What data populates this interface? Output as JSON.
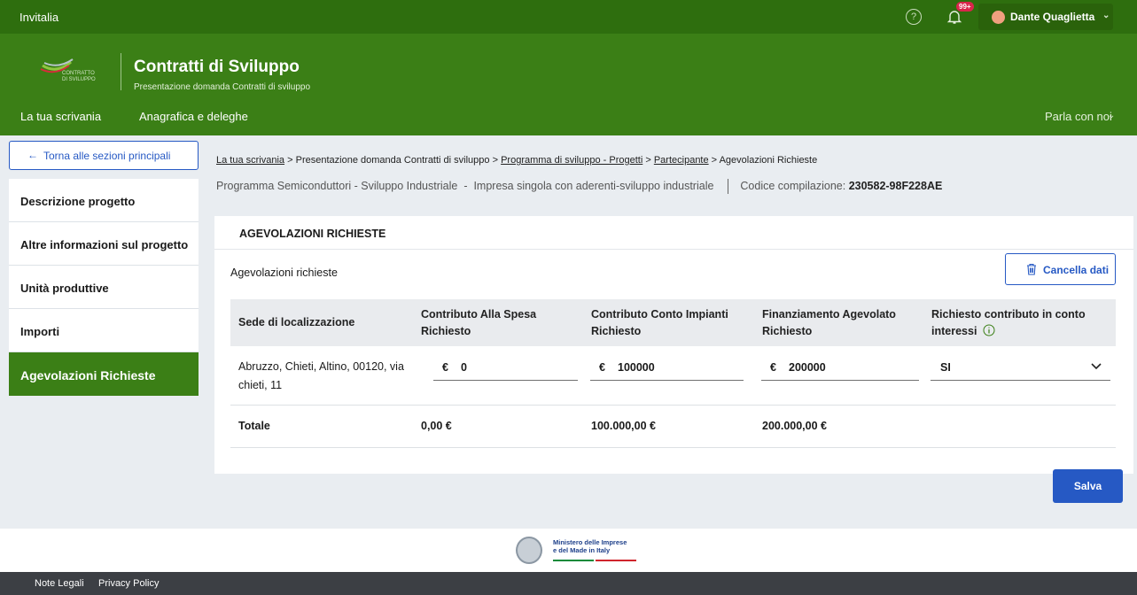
{
  "topbar": {
    "brand": "Invitalia",
    "help_glyph": "?",
    "notification_badge": "99+",
    "user_name": "Dante Quaglietta",
    "user_chevron": "⌄"
  },
  "header": {
    "logo_text_line1": "CONTRATTO",
    "logo_text_line2": "DI SVILUPPO",
    "title": "Contratti di Sviluppo",
    "subtitle": "Presentazione domanda Contratti di sviluppo",
    "nav": [
      "La tua scrivania",
      "Anagrafica e deleghe"
    ],
    "contact": "Parla con noi",
    "contact_chevron": "⌄"
  },
  "sidebar": {
    "back_arrow": "←",
    "back_label": "Torna alle sezioni principali",
    "items": [
      {
        "label": "Descrizione progetto"
      },
      {
        "label": "Altre informazioni sul progetto"
      },
      {
        "label": "Unità produttive"
      },
      {
        "label": "Importi"
      },
      {
        "label": "Agevolazioni Richieste",
        "active": true
      }
    ]
  },
  "breadcrumb": {
    "items": [
      "La tua scrivania",
      "Presentazione domanda Contratti di sviluppo",
      "Programma di sviluppo - Progetti",
      "Partecipante",
      "Agevolazioni Richieste"
    ],
    "separator": ">"
  },
  "meta": {
    "program": "Programma Semiconduttori - Sviluppo Industriale",
    "dash": "-",
    "type": "Impresa singola con aderenti-sviluppo industriale",
    "code_label": "Codice compilazione:",
    "code_value": "230582-98F228AE"
  },
  "panel": {
    "title": "AGEVOLAZIONI RICHIESTE",
    "section_label": "Agevolazioni richieste",
    "cancel_label": "Cancella dati",
    "columns": [
      "Sede di localizzazione",
      "Contributo Alla Spesa Richiesto",
      "Contributo Conto Impianti Richiesto",
      "Finanziamento Agevolato Richiesto",
      "Richiesto contributo in conto interessi"
    ],
    "rows": [
      {
        "sede": "Abruzzo, Chieti, Altino, 00120, via chieti, 11",
        "currency": "€",
        "contributo_spesa": "0",
        "contributo_impianti": "100000",
        "finanziamento": "200000",
        "contributo_interessi": "SI"
      }
    ],
    "totals": {
      "label": "Totale",
      "contributo_spesa": "0,00 €",
      "contributo_impianti": "100.000,00 €",
      "finanziamento": "200.000,00 €"
    }
  },
  "actions": {
    "save_label": "Salva"
  },
  "footer": {
    "ministry_line1": "Ministero delle Imprese",
    "ministry_line2": "e del Made in Italy",
    "links": [
      "Note Legali",
      "Privacy Policy"
    ]
  },
  "colors": {
    "top_bar": "#2e6e0e",
    "header": "#3b7f16",
    "primary_blue": "#2659c4",
    "footer": "#3c3f44"
  }
}
